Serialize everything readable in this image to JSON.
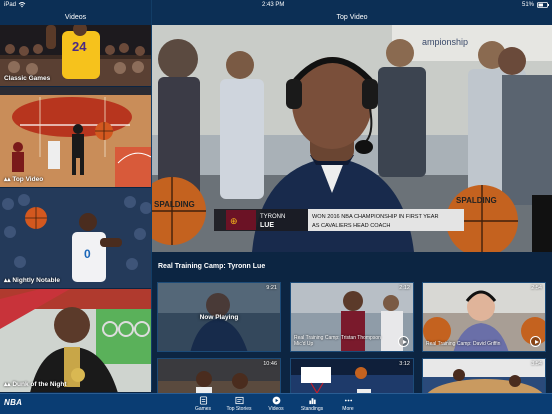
{
  "status_bar": {
    "device": "iPad",
    "wifi_icon": "wifi-icon",
    "time": "2:43 PM",
    "battery": "51%",
    "battery_icon": "battery-icon"
  },
  "headers": {
    "left": "Videos",
    "right": "Top Video"
  },
  "sidebar": {
    "items": [
      {
        "label": "Classic Games"
      },
      {
        "label": "Top Video"
      },
      {
        "label": "Nightly Notable"
      },
      {
        "label": "Dunk of the Night"
      }
    ],
    "jersey_number": "24",
    "nightly_jersey_number": "0"
  },
  "player": {
    "lower_third_name_first": "TYRONN",
    "lower_third_name_last": "LUE",
    "lower_third_line1": "WON 2016 NBA CHAMPIONSHIP IN FIRST YEAR",
    "lower_third_line2": "AS CAVALIERS HEAD COACH",
    "ball_text": "SPALDING",
    "bg_text": "ampionship"
  },
  "now_title": "Real Training Camp: Tyronn Lue",
  "thumbs": [
    {
      "duration": "9:21",
      "caption": "",
      "now_playing": "Now Playing"
    },
    {
      "duration": "2:12",
      "caption": "Real Training Camp: Tristan Thompson Mic'd Up",
      "now_playing": ""
    },
    {
      "duration": "2:54",
      "caption": "Real Training Camp: David Griffin",
      "now_playing": ""
    },
    {
      "duration": "10:46",
      "caption": "",
      "now_playing": ""
    },
    {
      "duration": "3:12",
      "caption": "",
      "now_playing": ""
    },
    {
      "duration": "3:54",
      "caption": "",
      "now_playing": ""
    }
  ],
  "tabbar": {
    "logo": "NBA",
    "tabs": [
      {
        "label": "Games",
        "icon": "games-icon"
      },
      {
        "label": "Top Stories",
        "icon": "top-stories-icon"
      },
      {
        "label": "Videos",
        "icon": "videos-icon"
      },
      {
        "label": "Standings",
        "icon": "standings-icon"
      },
      {
        "label": "More",
        "icon": "more-icon"
      }
    ]
  },
  "colors": {
    "navy": "#0c2542",
    "bar": "#0c2f55",
    "tab_bg": "#0a3d73",
    "accent": "#ffffff"
  }
}
